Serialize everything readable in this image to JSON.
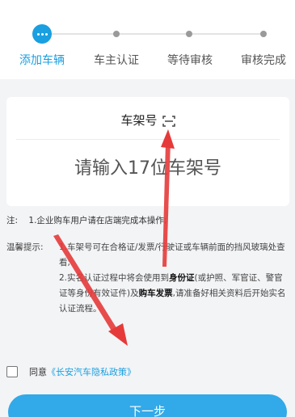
{
  "steps": [
    {
      "label": "添加车辆",
      "active": true
    },
    {
      "label": "车主认证",
      "active": false
    },
    {
      "label": "等待审核",
      "active": false
    },
    {
      "label": "审核完成",
      "active": false
    }
  ],
  "vin": {
    "title": "车架号",
    "scan_icon": "scan-icon",
    "placeholder": "请输入17位车架号"
  },
  "note": {
    "key": "注:",
    "text": "1.企业购车用户请在店端完成本操作;"
  },
  "tips": {
    "key": "温馨提示:",
    "line1": "1.车架号可在合格证/发票/行驶证或车辆前面的挡风玻璃处查看;",
    "line2_a": "2.实名认证过程中将会使用到",
    "line2_b": "身份证",
    "line2_c": "(或护照、军官证、警官证等身份有效证件)及",
    "line2_d": "购车发票",
    "line2_e": ",请准备好相关资料后开始实名认证流程。"
  },
  "agreement": {
    "prefix": "同意",
    "link": "《长安汽车隐私政策》"
  },
  "next_button": "下一步",
  "colors": {
    "accent": "#1a9fe0",
    "annotation_arrow": "#e63a3a"
  }
}
